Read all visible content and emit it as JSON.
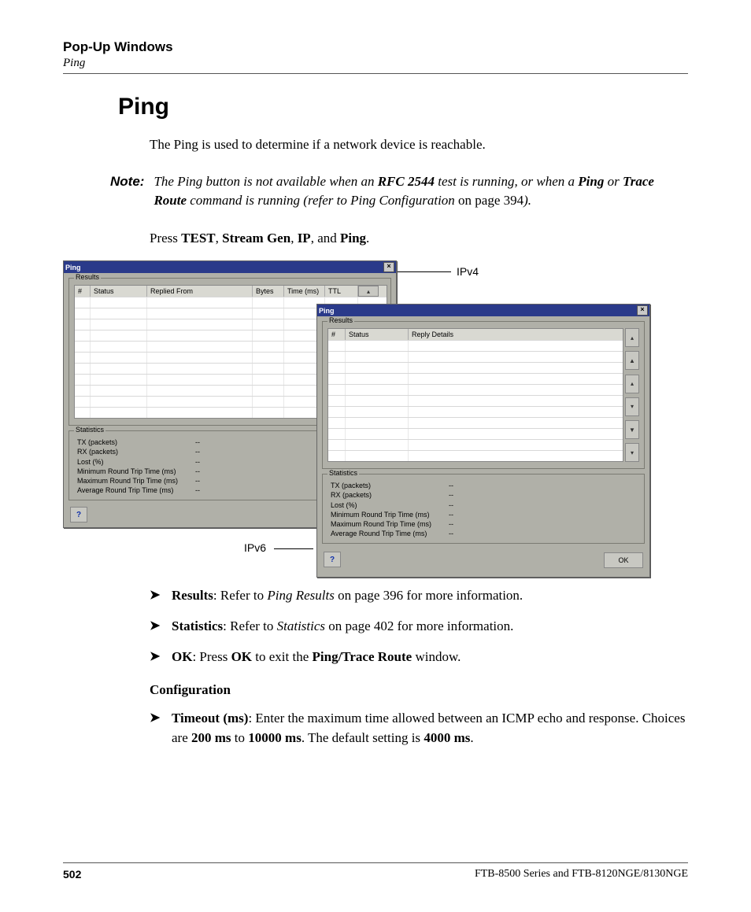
{
  "header": {
    "section_title": "Pop-Up Windows",
    "subtitle": "Ping"
  },
  "h1": "Ping",
  "intro": "The Ping is used to determine if a network device is reachable.",
  "note": {
    "label": "Note:",
    "part1": "The Ping button is not available when an ",
    "rfc": "RFC 2544",
    "part2": " test is running, or when a ",
    "ping_b": "Ping",
    "or": " or ",
    "tr_b": "Trace Route",
    "part3": " command is running (refer to Ping Configuration",
    "part3b": " on page 394",
    "part3c": ")."
  },
  "press_line": {
    "pre": "Press ",
    "t1": "TEST",
    "t2": "Stream Gen",
    "t3": "IP",
    "t4": "Ping",
    "comma": ", ",
    "and": ", and ",
    "period": "."
  },
  "figure": {
    "label_ipv4": "IPv4",
    "label_ipv6": "IPv6",
    "win_title": "Ping",
    "group_results": "Results",
    "group_statistics": "Statistics",
    "ipv4_cols": {
      "num": "#",
      "status": "Status",
      "replied": "Replied From",
      "bytes": "Bytes",
      "time": "Time (ms)",
      "ttl": "TTL"
    },
    "ipv6_cols": {
      "num": "#",
      "status": "Status",
      "reply": "Reply Details"
    },
    "stats": {
      "tx": "TX (packets)",
      "rx": "RX (packets)",
      "lost": "Lost (%)",
      "min": "Minimum Round Trip Time (ms)",
      "max": "Maximum Round Trip Time (ms)",
      "avg": "Average Round Trip Time (ms)",
      "val": "--"
    },
    "ok": "OK"
  },
  "bullets": {
    "results": {
      "b": "Results",
      "txt": ": Refer to ",
      "i": "Ping Results",
      "rest": " on page 396 for more information."
    },
    "stats": {
      "b": "Statistics",
      "txt": ": Refer to ",
      "i": "Statistics",
      "rest": " on page 402 for more information."
    },
    "ok": {
      "b": "OK",
      "txt": ": Press ",
      "b2": "OK",
      "mid": " to exit the ",
      "b3": "Ping/Trace Route",
      "rest": " window."
    }
  },
  "config_heading": "Configuration",
  "timeout": {
    "b": "Timeout (ms)",
    "txt": ": Enter the maximum time allowed between an ICMP echo and response. Choices are ",
    "v1": "200 ms",
    "to": " to ",
    "v2": "10000 ms",
    "mid": ". The default setting is ",
    "v3": "4000 ms",
    "end": "."
  },
  "footer": {
    "page": "502",
    "model": "FTB-8500 Series and FTB-8120NGE/8130NGE"
  }
}
